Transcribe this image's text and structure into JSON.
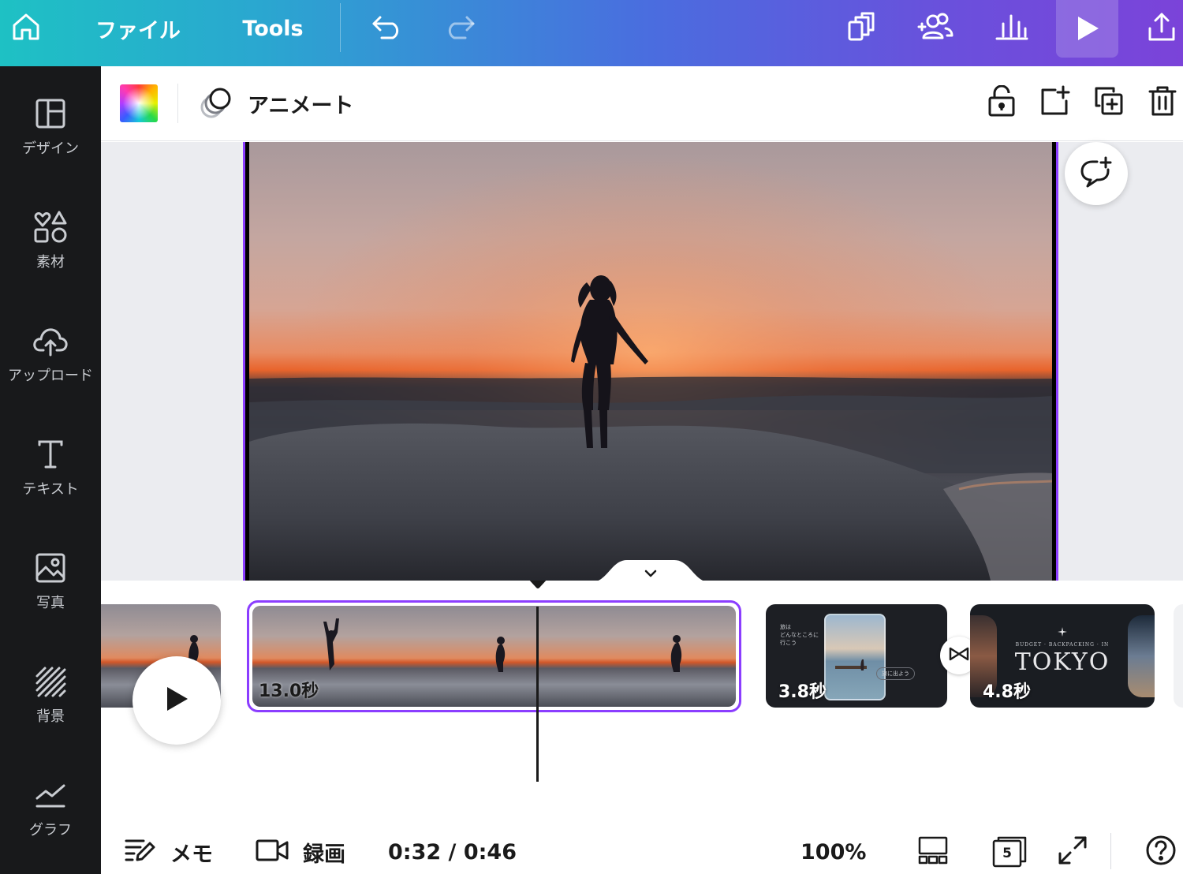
{
  "topbar": {
    "file_label": "ファイル",
    "tools_label": "Tools"
  },
  "sidebar": {
    "items": [
      {
        "label": "デザイン",
        "icon": "layout-icon"
      },
      {
        "label": "素材",
        "icon": "elements-icon"
      },
      {
        "label": "アップロード",
        "icon": "cloud-upload-icon"
      },
      {
        "label": "テキスト",
        "icon": "text-icon"
      },
      {
        "label": "写真",
        "icon": "photo-icon"
      },
      {
        "label": "背景",
        "icon": "background-icon"
      },
      {
        "label": "グラフ",
        "icon": "chart-icon"
      }
    ]
  },
  "toolbar": {
    "animate_label": "アニメート"
  },
  "timeline": {
    "selected_clip_duration": "13.0秒",
    "clips": [
      {
        "duration": "3.8秒",
        "overlay_lines": [
          "旅は",
          "どんなところに",
          "行こう"
        ],
        "caption": "旅に出よう"
      },
      {
        "duration": "4.8秒",
        "small_title": "BUDGET · BACKPACKING · IN",
        "title": "TOKYO"
      }
    ]
  },
  "bottombar": {
    "notes_label": "メモ",
    "record_label": "録画",
    "time": "0:32 / 0:46",
    "zoom": "100%",
    "page_count": "5"
  },
  "colors": {
    "accent": "#8b3dff",
    "sidebar_bg": "#18191b",
    "topbar_start": "#1ec1c4",
    "topbar_end": "#7b43d9"
  }
}
